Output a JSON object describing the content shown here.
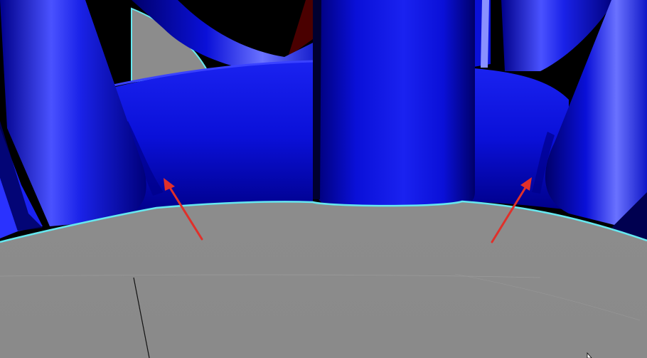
{
  "viewport": {
    "description_label": "",
    "colors": {
      "background": "#000000",
      "mesh_blue": "#0a10d8",
      "mesh_highlight": "#6a72ff",
      "mesh_shadow": "#00007a",
      "section_plane": "#8c8c8c",
      "section_edge": "#66e8f0",
      "annotation_arrow": "#e0302a",
      "dark_red": "#4a0000"
    },
    "icons": {
      "cursor": "mouse-cursor-icon",
      "arrow_left": "annotation-arrow-icon",
      "arrow_right": "annotation-arrow-icon"
    }
  }
}
